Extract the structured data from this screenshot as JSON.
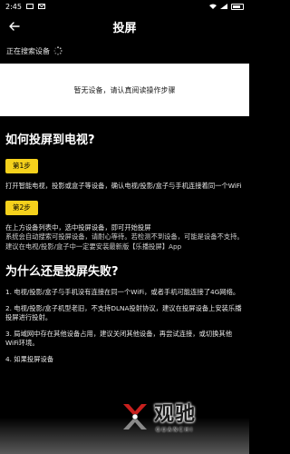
{
  "status_bar": {
    "time": "2:45"
  },
  "header": {
    "title": "投屏"
  },
  "search": {
    "status_text": "正在搜索设备"
  },
  "empty_state": {
    "text": "暂无设备，请认真阅读操作步骤"
  },
  "guide": {
    "title": "如何投屏到电视?",
    "steps": [
      {
        "badge": "第1步",
        "lines": [
          "打开智能电视，投影或盒子等设备，确认电视/投影/盒子与手机连接着同一个WiFi"
        ]
      },
      {
        "badge": "第2步",
        "lines": [
          "在上方设备列表中，选中投屏设备，即可开始投屏",
          "系统会自动搜索可投屏设备，请耐心等待。若检测不到设备，可能是设备不支持。",
          "建议在电视/投影/盒子中一定要安装最新版【乐播投屏】App"
        ]
      }
    ]
  },
  "failure": {
    "title": "为什么还是投屏失败?",
    "items": [
      "1. 电视/投影/盒子与手机没有连接在同一个WiFi，或者手机可能连接了4G网络。",
      "2. 电视/投影/盒子机型老旧，不支持DLNA投射协议，建议在投屏设备上安装乐播投屏进行投射。",
      "3. 局域网中存在其他设备占用，建议关闭其他设备，再尝试连接，或切换其他WiFi环境。",
      "4. 如果投屏设备"
    ]
  },
  "watermark": {
    "cn": "观驰",
    "en": "GUANCHI"
  },
  "colors": {
    "background": "#000000",
    "accent_yellow": "#f5d11c",
    "card_white": "#ffffff"
  }
}
